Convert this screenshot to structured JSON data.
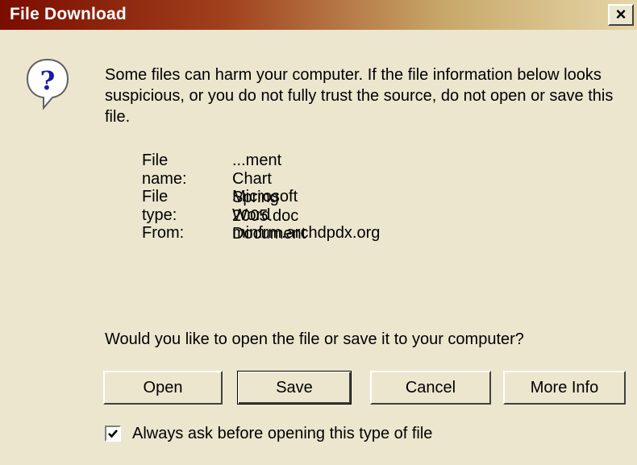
{
  "window": {
    "title": "File Download",
    "close_label": "×"
  },
  "icons": {
    "help": "question-mark-bubble-icon",
    "close": "close-icon",
    "check": "checkmark-icon"
  },
  "message": {
    "warning": "Some files can harm your computer. If the file information below looks suspicious, or you do not fully trust the source, do not open or save this file."
  },
  "file_info": {
    "name_label": "File name:",
    "name_value": "...ment Chart Spring 2005.doc",
    "type_label": "File type:",
    "type_value": "Microsoft Word Document",
    "from_label": "From:",
    "from_value": "minfrm.archdpdx.org"
  },
  "prompt": {
    "question": "Would you like to open the file or save it to your computer?"
  },
  "buttons": {
    "open": "Open",
    "save": "Save",
    "cancel": "Cancel",
    "more_info": "More Info"
  },
  "checkbox": {
    "label": "Always ask before opening this type of file",
    "checked": true
  },
  "colors": {
    "dialog_bg": "#ece6cf",
    "title_start": "#7b0c00",
    "title_end": "#e6d6a8",
    "icon_blue": "#1a1aa8"
  }
}
